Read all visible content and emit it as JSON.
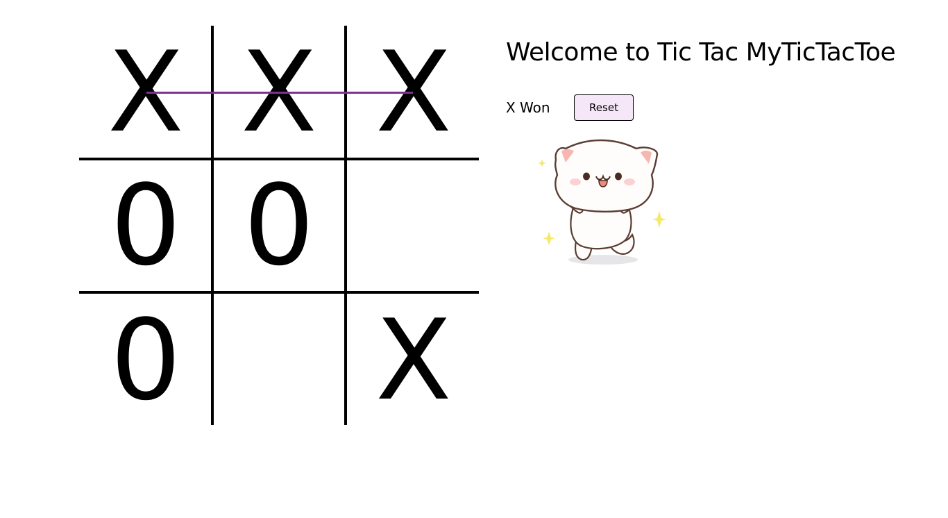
{
  "page": {
    "title": "Welcome to Tic Tac MyTicTacToe"
  },
  "game": {
    "status": "X Won",
    "reset_label": "Reset",
    "winner": "X",
    "board": [
      [
        "X",
        "X",
        "X"
      ],
      [
        "0",
        "0",
        ""
      ],
      [
        "0",
        "",
        "X"
      ]
    ],
    "win_line_color": "#7d3294"
  },
  "sticker": {
    "icon": "cat-celebrating-icon"
  },
  "colors": {
    "reset_bg": "#f5e6f8",
    "sparkle": "#f5e96a"
  }
}
